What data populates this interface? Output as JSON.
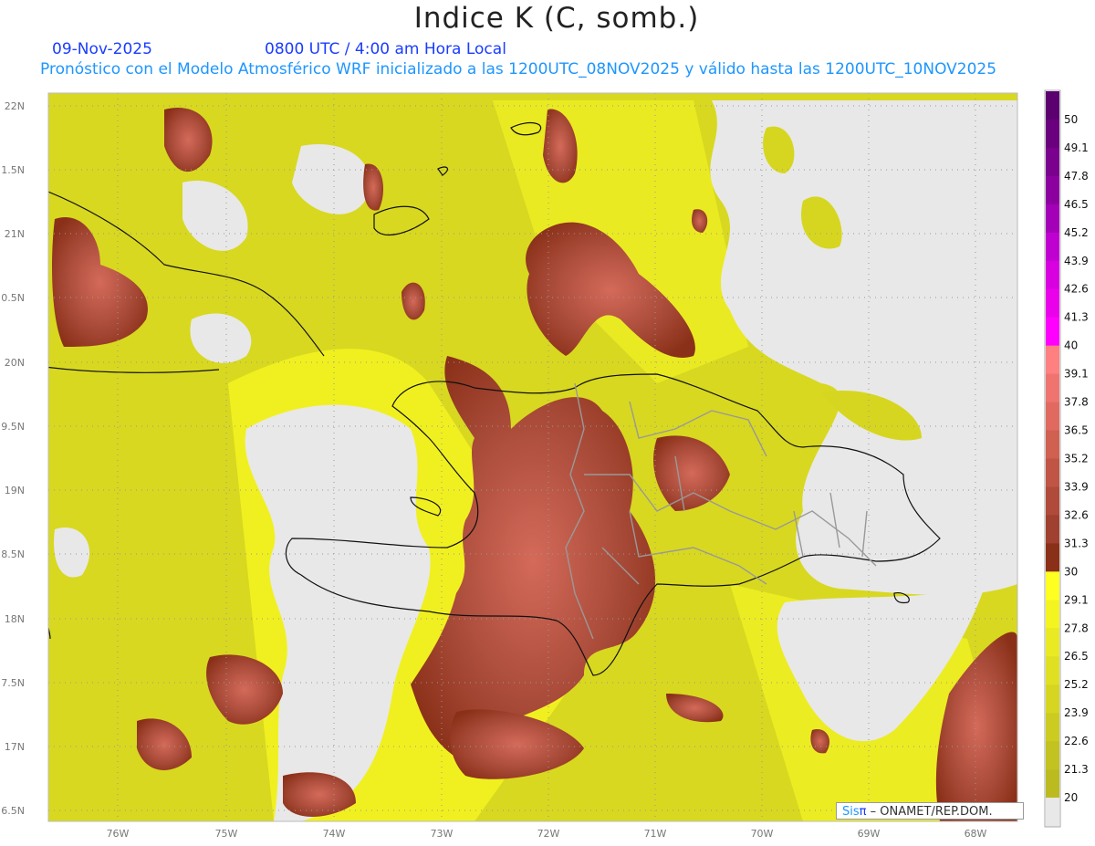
{
  "header": {
    "title": "Indice K (C, somb.)",
    "date": "09-Nov-2025",
    "time": "0800 UTC / 4:00 am Hora Local",
    "subtitle": "Pronóstico con el Modelo Atmosférico WRF inicializado a las 1200UTC_08NOV2025 y válido hasta las  1200UTC_10NOV2025"
  },
  "axes": {
    "lon_labels": [
      "76W",
      "75W",
      "74W",
      "73W",
      "72W",
      "71W",
      "70W",
      "69W",
      "68W"
    ],
    "lat_labels": [
      "22N",
      "1.5N",
      "21N",
      "0.5N",
      "20N",
      "9.5N",
      "19N",
      "8.5N",
      "18N",
      "7.5N",
      "17N",
      "6.5N"
    ]
  },
  "colorbar": {
    "labels": [
      "50",
      "49.1",
      "47.8",
      "46.5",
      "45.2",
      "43.9",
      "42.6",
      "41.3",
      "40",
      "39.1",
      "37.8",
      "36.5",
      "35.2",
      "33.9",
      "32.6",
      "31.3",
      "30",
      "29.1",
      "27.8",
      "26.5",
      "25.2",
      "23.9",
      "22.6",
      "21.3",
      "20"
    ],
    "colors": [
      "#5c0070",
      "#6a007e",
      "#7a008e",
      "#8c00a0",
      "#a400b8",
      "#c000d0",
      "#d800e0",
      "#ea00ea",
      "#ff00ff",
      "#ff8080",
      "#ef7470",
      "#e06a60",
      "#d06050",
      "#c05545",
      "#b04a3a",
      "#a04030",
      "#8a3018",
      "#ffff20",
      "#f4f420",
      "#eaea22",
      "#e0e022",
      "#d6d620",
      "#cccc20",
      "#c2c220",
      "#bbbb20",
      "#e8e8e8"
    ]
  },
  "logo": {
    "sis": "Sis",
    "pi": "π",
    "rest": "– ONAMET/REP.DOM."
  }
}
